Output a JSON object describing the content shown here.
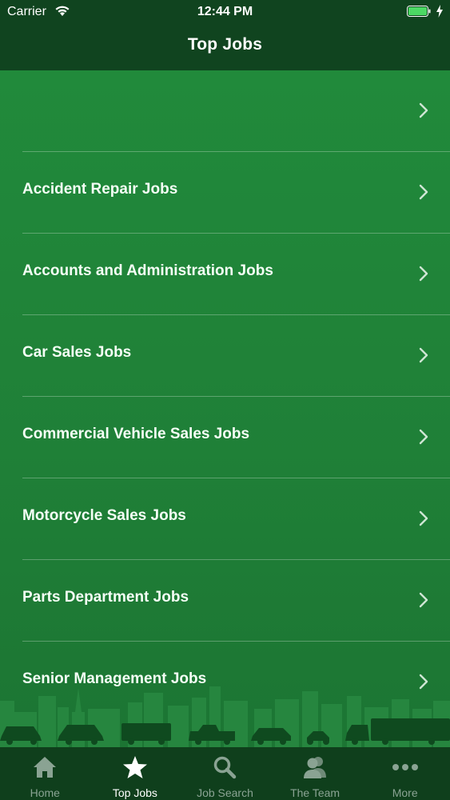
{
  "status_bar": {
    "carrier": "Carrier",
    "time": "12:44 PM"
  },
  "nav": {
    "title": "Top Jobs"
  },
  "job_categories": [
    {
      "label": ""
    },
    {
      "label": "Accident Repair Jobs"
    },
    {
      "label": "Accounts and Administration Jobs"
    },
    {
      "label": "Car Sales Jobs"
    },
    {
      "label": "Commercial Vehicle Sales Jobs"
    },
    {
      "label": "Motorcycle Sales Jobs"
    },
    {
      "label": "Parts Department Jobs"
    },
    {
      "label": "Senior Management Jobs"
    }
  ],
  "tabs": [
    {
      "label": "Home",
      "icon": "home-icon",
      "active": false
    },
    {
      "label": "Top Jobs",
      "icon": "star-icon",
      "active": true
    },
    {
      "label": "Job Search",
      "icon": "search-icon",
      "active": false
    },
    {
      "label": "The Team",
      "icon": "people-icon",
      "active": false
    },
    {
      "label": "More",
      "icon": "more-icon",
      "active": false
    }
  ],
  "colors": {
    "header_bg": "#10441f",
    "content_bg": "#218a3b",
    "tabbar_bg": "#0f3f1c",
    "tab_inactive": "#8aa393",
    "tab_active": "#ffffff"
  }
}
